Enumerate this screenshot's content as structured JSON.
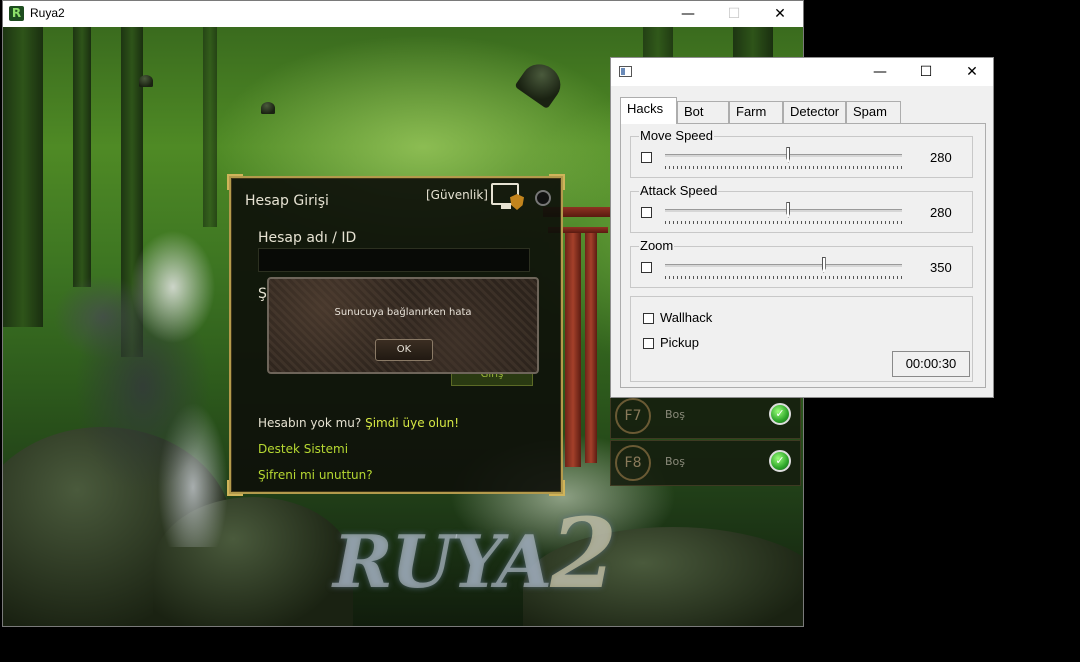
{
  "game_window": {
    "title": "Ruya2",
    "controls": {
      "minimize": "—",
      "maximize": "☐",
      "close": "✕"
    },
    "logo_text": "R"
  },
  "login": {
    "title": "Hesap Girişi",
    "security_label": "[Güvenlik]",
    "account_label": "Hesap adı / ID",
    "no_account_text": "Hesabın yok mu?",
    "signup_link": "Şimdi üye olun!",
    "support_link": "Destek Sistemi",
    "forgot_link": "Şifreni mi unuttun?",
    "partial_label": "Ş",
    "login_button": "Giriş"
  },
  "error_dialog": {
    "message": "Sunucuya bağlanırken hata",
    "ok_label": "OK"
  },
  "slots": [
    {
      "key": "F7",
      "label": "Boş"
    },
    {
      "key": "F8",
      "label": "Boş"
    }
  ],
  "hack_tool": {
    "controls": {
      "minimize": "—",
      "maximize": "☐",
      "close": "✕"
    },
    "tabs": [
      "Hacks",
      "Bot",
      "Farm",
      "Detector",
      "Spam"
    ],
    "active_tab": "Hacks",
    "sliders": [
      {
        "label": "Move Speed",
        "value": "280",
        "checked": false,
        "level": 0.52
      },
      {
        "label": "Attack Speed",
        "value": "280",
        "checked": false,
        "level": 0.52
      },
      {
        "label": "Zoom",
        "value": "350",
        "checked": false,
        "level": 0.67
      }
    ],
    "options": [
      {
        "label": "Wallhack",
        "checked": false
      },
      {
        "label": "Pickup",
        "checked": false
      }
    ],
    "timer": "00:00:30"
  },
  "colors": {
    "login_border": "#b39a4c",
    "link_highlight": "#d6e844",
    "green_link": "#b6d832",
    "slot_check": "#2ea52a"
  }
}
